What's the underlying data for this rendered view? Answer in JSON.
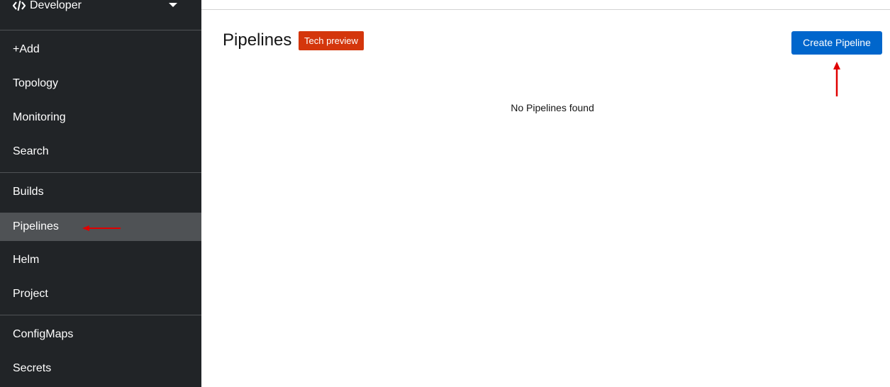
{
  "sidebar": {
    "perspective": {
      "label": "Developer",
      "icon": "code-icon"
    },
    "groups": [
      {
        "items": [
          {
            "label": "+Add"
          },
          {
            "label": "Topology"
          },
          {
            "label": "Monitoring"
          },
          {
            "label": "Search"
          }
        ]
      },
      {
        "items": [
          {
            "label": "Builds"
          },
          {
            "label": "Pipelines",
            "active": true
          },
          {
            "label": "Helm"
          },
          {
            "label": "Project"
          }
        ]
      },
      {
        "items": [
          {
            "label": "ConfigMaps"
          },
          {
            "label": "Secrets"
          }
        ]
      }
    ]
  },
  "main": {
    "title": "Pipelines",
    "badge": "Tech preview",
    "create_button": "Create Pipeline",
    "empty_message": "No Pipelines found"
  },
  "colors": {
    "sidebar_bg": "#212427",
    "active_item_bg": "#4f5255",
    "badge_bg": "#d4360c",
    "primary_button": "#0066cc",
    "annotation_arrow": "#e00000"
  }
}
